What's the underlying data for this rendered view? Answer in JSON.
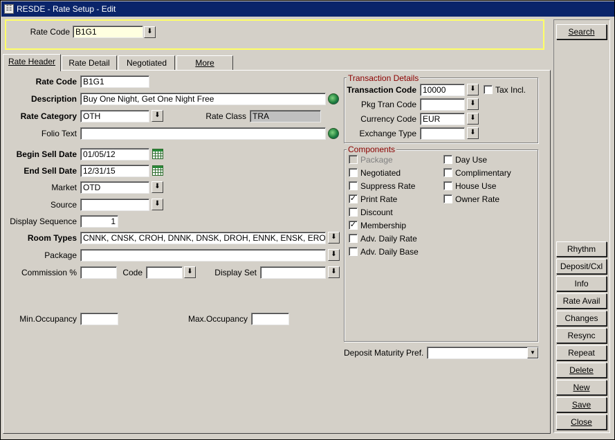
{
  "window": {
    "title": "RESDE - Rate Setup - Edit"
  },
  "search_bar": {
    "rate_code_label": "Rate Code",
    "rate_code_value": "B1G1"
  },
  "tabs": [
    {
      "label": "Rate Header",
      "active": true
    },
    {
      "label": "Rate Detail",
      "active": false
    },
    {
      "label": "Negotiated",
      "active": false
    },
    {
      "label": "More",
      "active": false
    }
  ],
  "form": {
    "rate_code": {
      "label": "Rate Code",
      "value": "B1G1"
    },
    "description": {
      "label": "Description",
      "value": "Buy One Night, Get One Night Free"
    },
    "rate_category": {
      "label": "Rate Category",
      "value": "OTH"
    },
    "rate_class": {
      "label": "Rate Class",
      "value": "TRA"
    },
    "folio_text": {
      "label": "Folio Text",
      "value": ""
    },
    "begin_sell_date": {
      "label": "Begin Sell Date",
      "value": "01/05/12"
    },
    "end_sell_date": {
      "label": "End Sell Date",
      "value": "12/31/15"
    },
    "market": {
      "label": "Market",
      "value": "OTD"
    },
    "source": {
      "label": "Source",
      "value": ""
    },
    "display_sequence": {
      "label": "Display Sequence",
      "value": "1"
    },
    "room_types": {
      "label": "Room Types",
      "value": "CNNK, CNSK, CROH, DNNK, DNSK, DROH, ENNK, ENSK, ERO"
    },
    "package": {
      "label": "Package",
      "value": ""
    },
    "commission": {
      "label": "Commission %",
      "value": ""
    },
    "code": {
      "label": "Code",
      "value": ""
    },
    "display_set": {
      "label": "Display Set",
      "value": ""
    },
    "min_occupancy": {
      "label": "Min.Occupancy",
      "value": ""
    },
    "max_occupancy": {
      "label": "Max.Occupancy",
      "value": ""
    }
  },
  "transaction_details": {
    "title": "Transaction Details",
    "transaction_code": {
      "label": "Transaction Code",
      "value": "10000"
    },
    "tax_incl": {
      "label": "Tax Incl.",
      "checked": false
    },
    "pkg_tran_code": {
      "label": "Pkg Tran Code",
      "value": ""
    },
    "currency_code": {
      "label": "Currency Code",
      "value": "EUR"
    },
    "exchange_type": {
      "label": "Exchange Type",
      "value": ""
    }
  },
  "components": {
    "title": "Components",
    "left": [
      {
        "label": "Package",
        "checked": false,
        "disabled": true
      },
      {
        "label": "Negotiated",
        "checked": false,
        "disabled": false
      },
      {
        "label": "Suppress Rate",
        "checked": false,
        "disabled": false
      },
      {
        "label": "Print Rate",
        "checked": true,
        "disabled": false
      },
      {
        "label": "Discount",
        "checked": false,
        "disabled": false
      },
      {
        "label": "Membership",
        "checked": true,
        "disabled": false
      },
      {
        "label": "Adv. Daily Rate",
        "checked": false,
        "disabled": false
      },
      {
        "label": "Adv. Daily Base",
        "checked": false,
        "disabled": false
      }
    ],
    "right": [
      {
        "label": "Day Use",
        "checked": false
      },
      {
        "label": "Complimentary",
        "checked": false
      },
      {
        "label": "House Use",
        "checked": false
      },
      {
        "label": "Owner Rate",
        "checked": false
      }
    ]
  },
  "deposit_maturity": {
    "label": "Deposit Maturity Pref.",
    "value": ""
  },
  "buttons": {
    "search": "Search",
    "rhythm": "Rhythm",
    "deposit_cxl": "Deposit/Cxl",
    "info": "Info",
    "rate_avail": "Rate Avail",
    "changes": "Changes",
    "resync": "Resync",
    "repeat": "Repeat",
    "delete": "Delete",
    "new": "New",
    "save": "Save",
    "close": "Close"
  },
  "icons": {
    "window": "application-icon",
    "dropdown": "download-arrow-icon",
    "translate": "globe-icon",
    "calendar": "calendar-icon"
  },
  "colors": {
    "titlebar": "#0a246a",
    "window_bg": "#d4d0c8",
    "search_highlight": "#ffff66",
    "group_title": "#8b0000",
    "rate_code_field": "#ffffe0"
  }
}
